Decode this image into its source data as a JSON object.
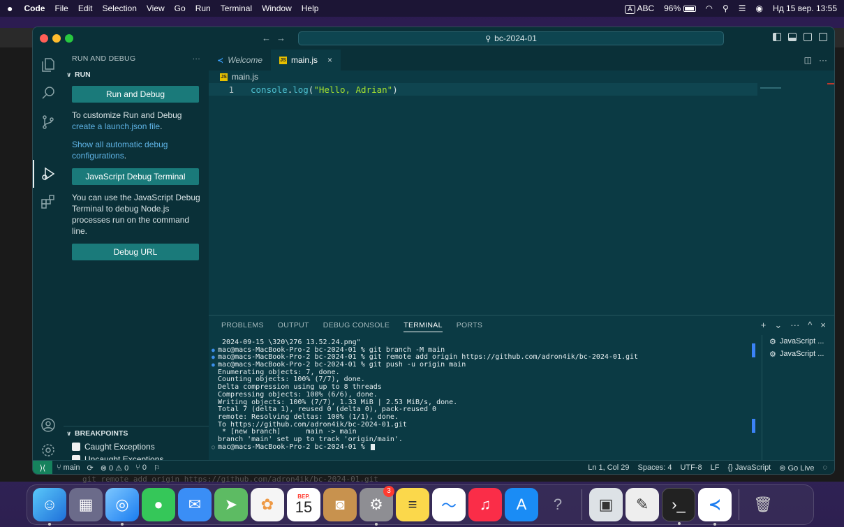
{
  "menubar": {
    "apple": "",
    "items": [
      "Code",
      "File",
      "Edit",
      "Selection",
      "View",
      "Go",
      "Run",
      "Terminal",
      "Window",
      "Help"
    ],
    "input_source": "A",
    "input_label": "ABC",
    "battery": "96%",
    "datetime": "Нд 15 вер. 13:55"
  },
  "titlebar": {
    "search": "bc-2024-01"
  },
  "sidebar": {
    "header": "RUN AND DEBUG",
    "more": "···",
    "run_section": "RUN",
    "run_debug_button": "Run and Debug",
    "customize_text": "To customize Run and Debug",
    "create_link": "create a launch.json file",
    "create_suffix": ".",
    "show_link": "Show all automatic debug configurations",
    "show_suffix": ".",
    "js_terminal_button": "JavaScript Debug Terminal",
    "js_terminal_text": "You can use the JavaScript Debug Terminal to debug Node.js processes run on the command line.",
    "debug_url_button": "Debug URL",
    "breakpoints_section": "BREAKPOINTS",
    "breakpoints": [
      {
        "label": "Caught Exceptions"
      },
      {
        "label": "Uncaught Exceptions"
      }
    ]
  },
  "editor": {
    "tabs": [
      {
        "label": "Welcome"
      },
      {
        "label": "main.js"
      }
    ],
    "tab_close": "×",
    "breadcrumb": "main.js",
    "line_number": "1",
    "code": {
      "fn": "console",
      "dot": ".",
      "method": "log",
      "open": "(",
      "str": "\"Hello, Adrian\"",
      "close": ")"
    }
  },
  "panel": {
    "tabs": [
      "PROBLEMS",
      "OUTPUT",
      "DEBUG CONSOLE",
      "TERMINAL",
      "PORTS"
    ],
    "active_tab": "TERMINAL",
    "actions": [
      "+",
      "⌄",
      "···",
      "^",
      "×"
    ],
    "terminal_lines": [
      {
        "dot": "",
        "text": " 2024-09-15 \\320\\276 13.52.24.png\""
      },
      {
        "dot": "blue",
        "text": "mac@macs-MacBook-Pro-2 bc-2024-01 % git branch -M main"
      },
      {
        "dot": "blue",
        "text": "mac@macs-MacBook-Pro-2 bc-2024-01 % git remote add origin https://github.com/adron4ik/bc-2024-01.git"
      },
      {
        "dot": "blue",
        "text": "mac@macs-MacBook-Pro-2 bc-2024-01 % git push -u origin main"
      },
      {
        "dot": "",
        "text": "Enumerating objects: 7, done."
      },
      {
        "dot": "",
        "text": "Counting objects: 100% (7/7), done."
      },
      {
        "dot": "",
        "text": "Delta compression using up to 8 threads"
      },
      {
        "dot": "",
        "text": "Compressing objects: 100% (6/6), done."
      },
      {
        "dot": "",
        "text": "Writing objects: 100% (7/7), 1.33 MiB | 2.53 MiB/s, done."
      },
      {
        "dot": "",
        "text": "Total 7 (delta 1), reused 0 (delta 0), pack-reused 0"
      },
      {
        "dot": "",
        "text": "remote: Resolving deltas: 100% (1/1), done."
      },
      {
        "dot": "",
        "text": "To https://github.com/adron4ik/bc-2024-01.git"
      },
      {
        "dot": "",
        "text": " * [new branch]      main -> main"
      },
      {
        "dot": "",
        "text": "branch 'main' set up to track 'origin/main'."
      },
      {
        "dot": "hollow",
        "text": "mac@macs-MacBook-Pro-2 bc-2024-01 % "
      }
    ],
    "terminal_list": [
      "JavaScript ...",
      "JavaScript ..."
    ]
  },
  "statusbar": {
    "remote": "⟩⟨",
    "branch": "main",
    "sync": "⟳",
    "problems": "⊗ 0 ⚠ 0",
    "ports": "⑂ 0",
    "debug": "⚐",
    "position": "Ln 1, Col 29",
    "spaces": "Spaces: 4",
    "encoding": "UTF-8",
    "eol": "LF",
    "language": "{} JavaScript",
    "golive": "Go Live",
    "bell": "🔔"
  },
  "behind": {
    "text": "git remote add origin https://github.com/adron4ik/bc-2024-01.git"
  },
  "dock": {
    "calendar_month": "ВЕР.",
    "calendar_day": "15",
    "settings_badge": "3",
    "help_glyph": "?"
  },
  "colors": {
    "accent": "#1a7a7a",
    "editor_bg": "#0b3a44",
    "sidebar_bg": "#0a3038",
    "link": "#5fb4e6"
  }
}
